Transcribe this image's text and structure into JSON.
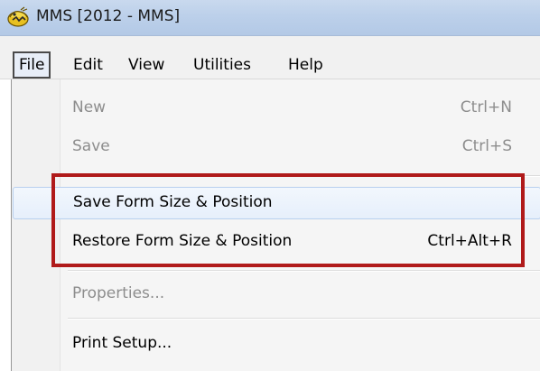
{
  "window": {
    "title": "MMS [2012 - MMS]",
    "app_icon": "app-logo-icon"
  },
  "menubar": {
    "items": [
      {
        "label": "File",
        "active": true
      },
      {
        "label": "Edit"
      },
      {
        "label": "View"
      },
      {
        "label": "Utilities"
      },
      {
        "label": "Help"
      }
    ]
  },
  "file_menu": {
    "items": [
      {
        "label": "New",
        "shortcut": "Ctrl+N",
        "enabled": false
      },
      {
        "label": "Save",
        "shortcut": "Ctrl+S",
        "enabled": false
      },
      {
        "label": "Save Form Size & Position",
        "shortcut": "",
        "enabled": true,
        "hovered": true
      },
      {
        "label": "Restore Form Size & Position",
        "shortcut": "Ctrl+Alt+R",
        "enabled": true
      },
      {
        "label": "Properties...",
        "shortcut": "",
        "enabled": false
      },
      {
        "label": "Print Setup...",
        "shortcut": "",
        "enabled": true
      }
    ]
  },
  "colors": {
    "annotation_box": "#b01a1a",
    "hover_bg": "#e6effb",
    "disabled_text": "#8d8d8d"
  }
}
